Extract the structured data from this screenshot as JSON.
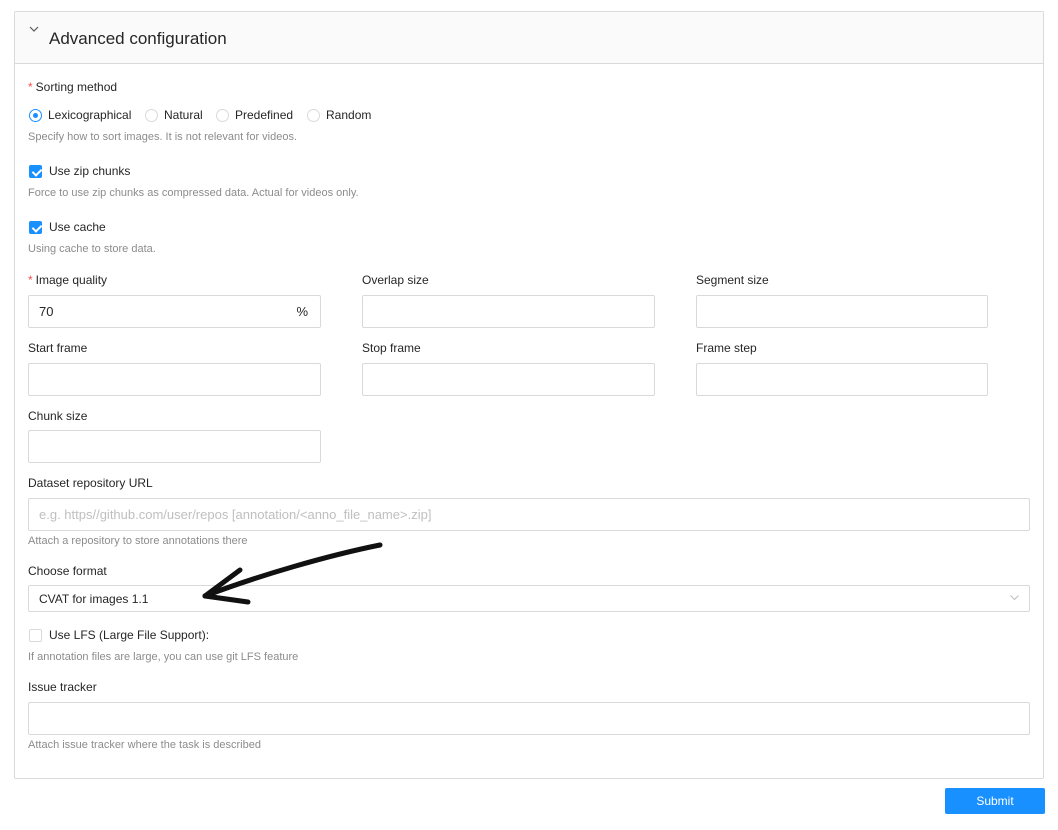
{
  "panel": {
    "title": "Advanced configuration"
  },
  "sorting": {
    "label": "Sorting method",
    "options": [
      "Lexicographical",
      "Natural",
      "Predefined",
      "Random"
    ],
    "selected": "Lexicographical",
    "help": "Specify how to sort images. It is not relevant for videos."
  },
  "zip_chunks": {
    "label": "Use zip chunks",
    "checked": true,
    "help": "Force to use zip chunks as compressed data. Actual for videos only."
  },
  "cache": {
    "label": "Use cache",
    "checked": true,
    "help": "Using cache to store data."
  },
  "fields": {
    "image_quality": {
      "label": "Image quality",
      "value": "70",
      "suffix": "%"
    },
    "overlap_size": {
      "label": "Overlap size",
      "value": ""
    },
    "segment_size": {
      "label": "Segment size",
      "value": ""
    },
    "start_frame": {
      "label": "Start frame",
      "value": ""
    },
    "stop_frame": {
      "label": "Stop frame",
      "value": ""
    },
    "frame_step": {
      "label": "Frame step",
      "value": ""
    },
    "chunk_size": {
      "label": "Chunk size",
      "value": ""
    }
  },
  "repository": {
    "label": "Dataset repository URL",
    "placeholder": "e.g. https//github.com/user/repos [annotation/<anno_file_name>.zip]",
    "help": "Attach a repository to store annotations there"
  },
  "format": {
    "label": "Choose format",
    "value": "CVAT for images 1.1"
  },
  "lfs": {
    "label": "Use LFS (Large File Support):",
    "checked": false,
    "help": "If annotation files are large, you can use git LFS feature"
  },
  "issue_tracker": {
    "label": "Issue tracker",
    "value": "",
    "help": "Attach issue tracker where the task is described"
  },
  "submit": {
    "label": "Submit"
  },
  "colors": {
    "accent": "#1890ff",
    "required": "#ff4d4f",
    "border": "#d9d9d9",
    "help_text": "#8c8c8c"
  }
}
